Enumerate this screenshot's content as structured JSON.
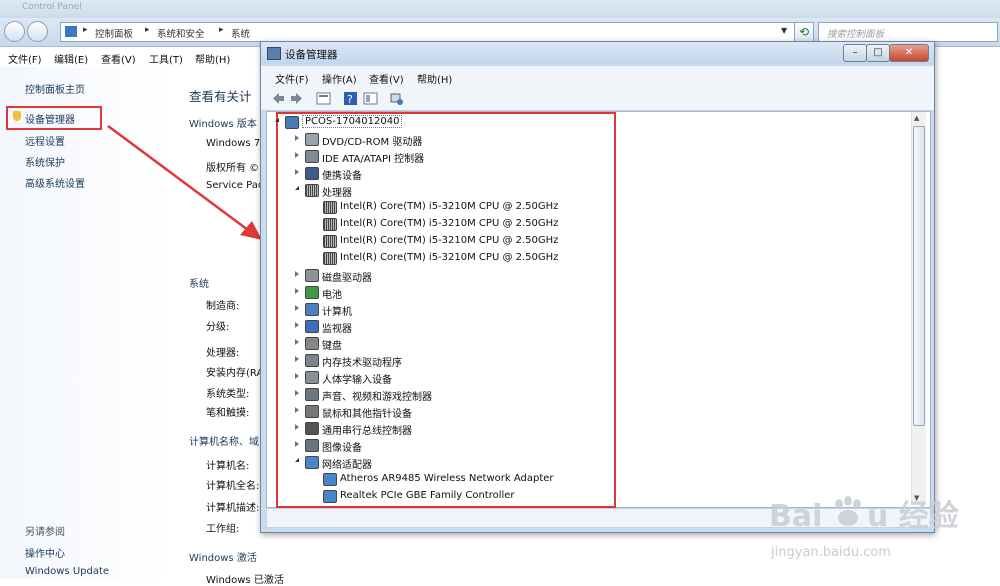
{
  "background_window": {
    "address": [
      "控制面板",
      "系统和安全",
      "系统"
    ],
    "search_placeholder": "搜索控制面板",
    "menu": [
      "文件(F)",
      "编辑(E)",
      "查看(V)",
      "工具(T)",
      "帮助(H)"
    ],
    "left_pane": {
      "items": [
        "控制面板主页",
        "设备管理器",
        "远程设置",
        "系统保护",
        "高级系统设置"
      ],
      "see_also_title": "另请参阅",
      "see_also": [
        "操作中心",
        "Windows Update"
      ]
    },
    "main": {
      "heading": "查看有关计",
      "windows_edition": "Windows 版本",
      "windows_lines": [
        "Windows 7",
        "版权所有 ©",
        "Service Pac"
      ],
      "system_section": "系统",
      "system_fields": [
        "制造商:",
        "分级:",
        "处理器:",
        "安装内存(RA",
        "系统类型:",
        "笔和触摸:"
      ],
      "computer_section": "计算机名称、域",
      "computer_fields": [
        "计算机名:",
        "计算机全名:",
        "计算机描述:",
        "工作组:"
      ],
      "activation_section": "Windows 激活",
      "activation_line": "Windows 已激活"
    }
  },
  "device_manager": {
    "title": "设备管理器",
    "menu": [
      "文件(F)",
      "操作(A)",
      "查看(V)",
      "帮助(H)"
    ],
    "window_buttons": {
      "minimize": "–",
      "maximize": "□",
      "close": "✕"
    },
    "tree": [
      {
        "label": "PCOS-1704012040",
        "level": 0,
        "expanded": true,
        "icon": "computer-root-icon",
        "selected": true
      },
      {
        "label": "DVD/CD-ROM 驱动器",
        "level": 1,
        "icon": "dvd-drive-icon"
      },
      {
        "label": "IDE ATA/ATAPI 控制器",
        "level": 1,
        "icon": "ide-controller-icon"
      },
      {
        "label": "便携设备",
        "level": 1,
        "icon": "portable-device-icon"
      },
      {
        "label": "处理器",
        "level": 1,
        "expanded": true,
        "icon": "processor-icon"
      },
      {
        "label": "Intel(R) Core(TM) i5-3210M CPU @ 2.50GHz",
        "level": 2,
        "icon": "cpu-icon"
      },
      {
        "label": "Intel(R) Core(TM) i5-3210M CPU @ 2.50GHz",
        "level": 2,
        "icon": "cpu-icon"
      },
      {
        "label": "Intel(R) Core(TM) i5-3210M CPU @ 2.50GHz",
        "level": 2,
        "icon": "cpu-icon"
      },
      {
        "label": "Intel(R) Core(TM) i5-3210M CPU @ 2.50GHz",
        "level": 2,
        "icon": "cpu-icon"
      },
      {
        "label": "磁盘驱动器",
        "level": 1,
        "icon": "disk-drive-icon"
      },
      {
        "label": "电池",
        "level": 1,
        "icon": "battery-icon"
      },
      {
        "label": "计算机",
        "level": 1,
        "icon": "computer-icon"
      },
      {
        "label": "监视器",
        "level": 1,
        "icon": "monitor-icon"
      },
      {
        "label": "键盘",
        "level": 1,
        "icon": "keyboard-icon"
      },
      {
        "label": "内存技术驱动程序",
        "level": 1,
        "icon": "memory-icon"
      },
      {
        "label": "人体学输入设备",
        "level": 1,
        "icon": "hid-icon"
      },
      {
        "label": "声音、视频和游戏控制器",
        "level": 1,
        "icon": "sound-icon"
      },
      {
        "label": "鼠标和其他指针设备",
        "level": 1,
        "icon": "mouse-icon"
      },
      {
        "label": "通用串行总线控制器",
        "level": 1,
        "icon": "usb-icon"
      },
      {
        "label": "图像设备",
        "level": 1,
        "icon": "imaging-icon"
      },
      {
        "label": "网络适配器",
        "level": 1,
        "expanded": true,
        "icon": "network-icon"
      },
      {
        "label": "Atheros AR9485 Wireless Network Adapter",
        "level": 2,
        "icon": "network-adapter-icon"
      },
      {
        "label": "Realtek PCIe GBE Family Controller",
        "level": 2,
        "icon": "network-adapter-icon"
      }
    ]
  },
  "watermark": {
    "brand": "Baidu 经验",
    "url": "jingyan.baidu.com"
  },
  "colors": {
    "highlight_red": "#e03838",
    "link_blue": "#1e395b",
    "chrome_blue": "#c9dbef"
  }
}
